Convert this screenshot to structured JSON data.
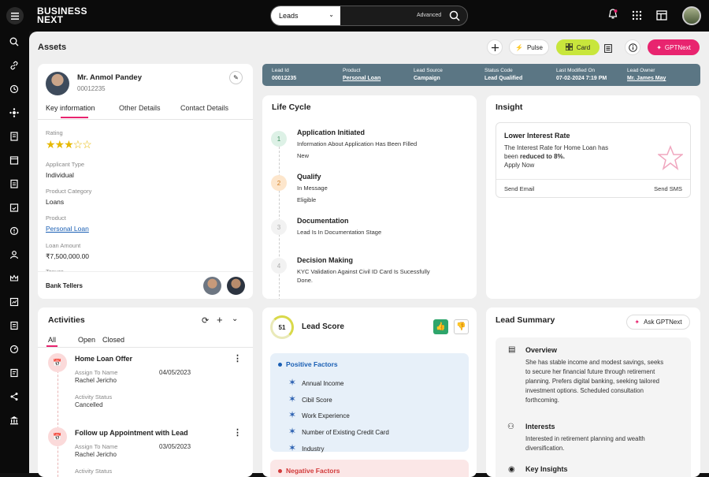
{
  "brand": {
    "line1": "BUSINESS",
    "line2": "NEXT"
  },
  "search": {
    "selected": "Leads",
    "advanced": "Advanced"
  },
  "page_title": "Assets",
  "toolbar": {
    "pulse": "Pulse",
    "card": "Card",
    "gptnext": "GPTNext"
  },
  "profile": {
    "name": "Mr. Anmol Pandey",
    "id": "00012235",
    "tabs": [
      "Key information",
      "Other Details",
      "Contact Details"
    ],
    "fields": [
      {
        "label": "Rating",
        "value": "",
        "stars": 3
      },
      {
        "label": "Applicant Type",
        "value": "Individual"
      },
      {
        "label": "Product Category",
        "value": "Loans"
      },
      {
        "label": "Product",
        "value": "Personal Loan"
      },
      {
        "label": "Loan Amount",
        "value": "₹7,500,000.00"
      },
      {
        "label": "Tenure",
        "value": ""
      }
    ],
    "bank_tellers": "Bank Tellers"
  },
  "lead_bar": [
    {
      "label": "Lead Id",
      "value": "00012235"
    },
    {
      "label": "Product",
      "value": "Personal Loan"
    },
    {
      "label": "Lead Source",
      "value": "Campaign"
    },
    {
      "label": "Status Code",
      "value": "Lead Qualified"
    },
    {
      "label": "Last Modified On",
      "value": "07-02-2024 7:19 PM"
    },
    {
      "label": "Lead Owner",
      "value": "Mr. James May"
    }
  ],
  "lifecycle": {
    "title": "Life Cycle",
    "steps": [
      {
        "n": "1",
        "title": "Application Initiated",
        "desc": "Information About Application Has Been Filled",
        "desc2": "New"
      },
      {
        "n": "2",
        "title": "Qualify",
        "desc": "In Message",
        "desc2": "Eligible"
      },
      {
        "n": "3",
        "title": "Documentation",
        "desc": "Lead Is In Documentation Stage",
        "desc2": ""
      },
      {
        "n": "4",
        "title": "Decision Making",
        "desc": "KYC Validation Against Civil ID Card Is Sucessfully",
        "desc2": "Done."
      }
    ]
  },
  "insight": {
    "title": "Insight",
    "card_title": "Lower Interest Rate",
    "line1": "The Interest Rate for Home Loan has",
    "line2a": "been ",
    "line2b": "reduced to 8%.",
    "line3": "Apply Now",
    "send_email": "Send Email",
    "send_sms": "Send SMS"
  },
  "activities": {
    "title": "Activities",
    "tabs": [
      "All",
      "Open",
      "Closed"
    ],
    "items": [
      {
        "title": "Home Loan Offer",
        "assign_label": "Assign To Name",
        "assign": "Rachel Jericho",
        "date": "04/05/2023",
        "status_label": "Activity Status",
        "status": "Cancelled"
      },
      {
        "title": "Follow up Appointment with Lead",
        "assign_label": "Assign To Name",
        "assign": "Rachel Jericho",
        "date": "03/05/2023",
        "status_label": "Activity Status",
        "status": ""
      }
    ]
  },
  "lead_score": {
    "score": "51",
    "title": "Lead Score",
    "positive_title": "Positive Factors",
    "positive": [
      "Annual Income",
      "Cibil Score",
      "Work Experience",
      "Number of Existing Credit Card",
      "Industry"
    ],
    "negative_title": "Negative Factors"
  },
  "summary": {
    "title": "Lead Summary",
    "ask": "Ask GPTNext",
    "overview_title": "Overview",
    "overview": [
      "She has stable income and modest savings, seeks",
      "to secure her financial future through retirement",
      "planning. Prefers digital banking, seeking tailored",
      "investment options. Scheduled consultation",
      "forthcoming."
    ],
    "interests_title": "Interests",
    "interests": [
      "Interested in retirement planning and wealth",
      "diversification."
    ],
    "insights_title": "Key Insights"
  },
  "colors": {
    "accent_pink": "#e8246f",
    "lime": "#c8e63c",
    "lead_bar": "#5b7684",
    "star": "#e6b800"
  }
}
